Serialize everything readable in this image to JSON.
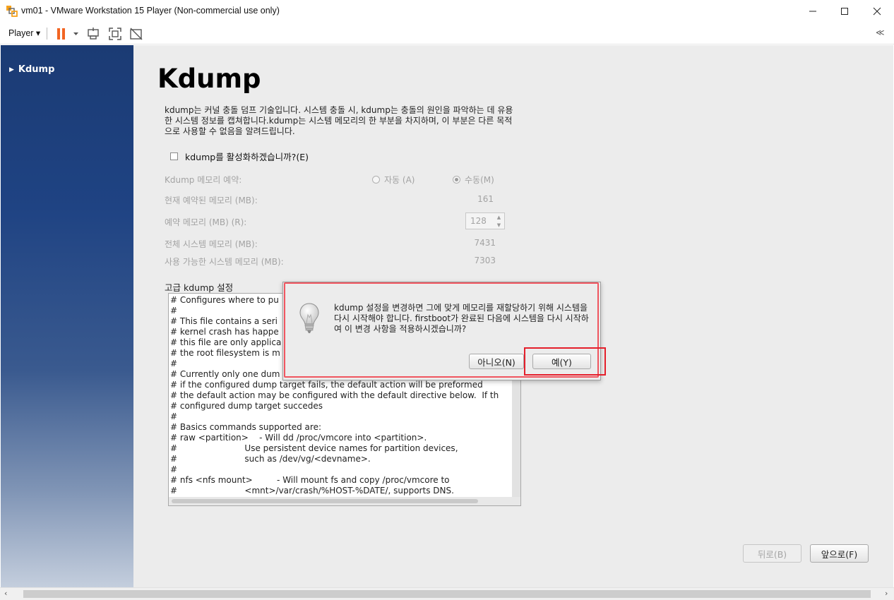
{
  "window": {
    "title": "vm01 - VMware Workstation 15 Player (Non-commercial use only)",
    "minimize": "—",
    "maximize": "☐",
    "close": "✕"
  },
  "toolbar": {
    "player_menu": "Player ▾",
    "collapse": "≪"
  },
  "sidebar": {
    "items": [
      {
        "label": "Kdump"
      }
    ]
  },
  "page": {
    "title": "Kdump",
    "description": "kdump는 커널 충돌 덤프 기술입니다. 시스템 충돌 시, kdump는 충돌의 원인을 파악하는 데 유용한 시스템 정보를 캡쳐합니다.kdump는 시스템 메모리의 한 부분을 차지하며, 이 부분은 다른 목적으로 사용할 수 없음을 알려드립니다.",
    "enable_label": "kdump를 활성화하겠습니까?(E)",
    "memory_reserve_label": "Kdump 메모리 예약:",
    "radio_auto": "자동 (A)",
    "radio_manual": "수동(M)",
    "current_reserved_label": "현재 예약된 메모리 (MB):",
    "current_reserved_value": "161",
    "reserve_memory_label": "예약 메모리 (MB) (R):",
    "reserve_memory_value": "128",
    "total_memory_label": "전체 시스템 메모리 (MB):",
    "total_memory_value": "7431",
    "available_memory_label": "사용 가능한 시스템 메모리 (MB):",
    "available_memory_value": "7303",
    "advanced_label": "고급 kdump 설정",
    "config_lines": [
      "# Configures where to pu",
      "#",
      "# This file contains a seri",
      "# kernel crash has happe",
      "# this file are only applica",
      "# the root filesystem is m",
      "#",
      "# Currently only one dum",
      "# if the configured dump target fails, the default action will be preformed",
      "# the default action may be configured with the default directive below.  If th",
      "# configured dump target succedes",
      "#",
      "# Basics commands supported are:",
      "# raw <partition>    - Will dd /proc/vmcore into <partition>.",
      "#                         Use persistent device names for partition devices,",
      "#                         such as /dev/vg/<devname>.",
      "#",
      "# nfs <nfs mount>         - Will mount fs and copy /proc/vmcore to",
      "#                         <mnt>/var/crash/%HOST-%DATE/, supports DNS."
    ],
    "back_button": "뒤로(B)",
    "forward_button": "앞으로(F)"
  },
  "dialog": {
    "message": "kdump 설정을 변경하면 그에 맞게 메모리를 재할당하기 위해 시스템을 다시 시작해야 합니다. firstboot가 완료된 다음에 시스템을 다시 시작하여 이 변경 사항을 적용하시겠습니까?",
    "no_button": "아니오(N)",
    "yes_button": "예(Y)"
  },
  "colors": {
    "highlight_red": "#e41f2b",
    "pause_orange": "#f26522",
    "sidebar_blue": "#1f4383"
  }
}
